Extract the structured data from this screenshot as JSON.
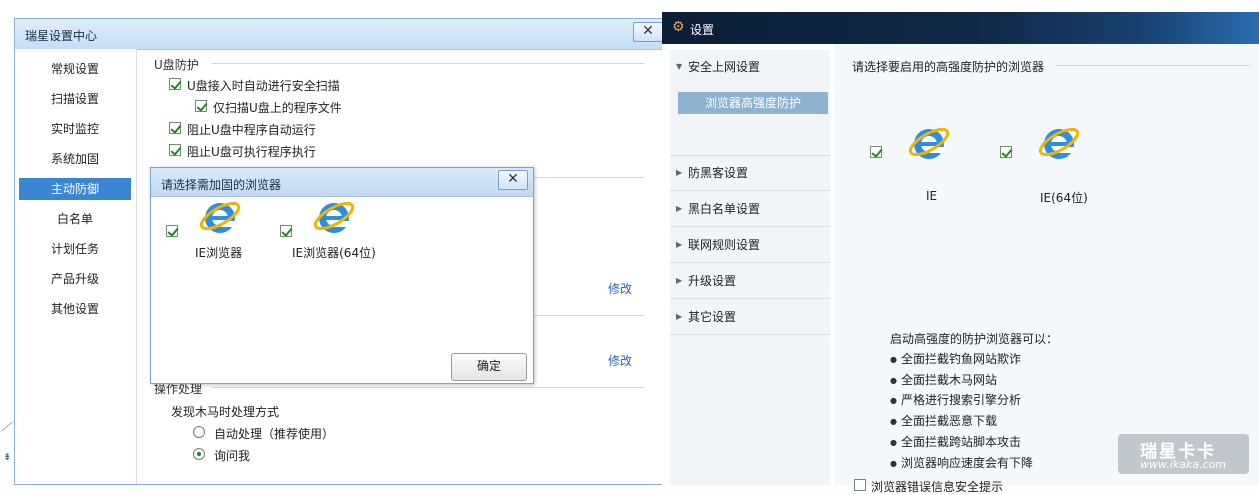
{
  "left_window": {
    "title": "瑞星设置中心",
    "close": "✕",
    "nav": [
      "常规设置",
      "扫描设置",
      "实时监控",
      "系统加固",
      "主动防御",
      "白名单",
      "计划任务",
      "产品升级",
      "其他设置"
    ],
    "active_index": 4,
    "usb_section": {
      "title": "U盘防护",
      "options": [
        {
          "label": "U盘接入时自动进行安全扫描",
          "checked": true
        },
        {
          "label": "仅扫描U盘上的程序文件",
          "checked": true
        },
        {
          "label": "阻止U盘中程序自动运行",
          "checked": true
        },
        {
          "label": "阻止U盘可执行程序执行",
          "checked": true
        }
      ]
    },
    "modify_1": "修改",
    "modify_2": "修改",
    "handle_section": {
      "title": "操作处理",
      "question": "发现木马时处理方式",
      "options": [
        {
          "label": "自动处理（推荐使用）",
          "selected": false
        },
        {
          "label": "询问我",
          "selected": true
        }
      ]
    }
  },
  "modal": {
    "title": "请选择需加固的浏览器",
    "close": "✕",
    "browsers": [
      {
        "label": "IE浏览器",
        "checked": true
      },
      {
        "label": "IE浏览器(64位)",
        "checked": true
      }
    ],
    "ok": "确定"
  },
  "right_window": {
    "title": "设置",
    "nav_group": "安全上网设置",
    "nav_sub_active": "浏览器高强度防护",
    "nav_items": [
      "防黑客设置",
      "黑白名单设置",
      "联网规则设置",
      "升级设置",
      "其它设置"
    ],
    "main_heading": "请选择要启用的高强度防护的浏览器",
    "browsers": [
      {
        "label": "IE",
        "checked": true
      },
      {
        "label": "IE(64位)",
        "checked": true
      }
    ],
    "info_heading": "启动高强度的防护浏览器可以：",
    "bullets": [
      "全面拦截钓鱼网站欺诈",
      "全面拦截木马网站",
      "严格进行搜索引擎分析",
      "全面拦截恶意下载",
      "全面拦截跨站脚本攻击",
      "浏览器响应速度会有下降"
    ],
    "bottom_option": {
      "label": "浏览器错误信息安全提示",
      "checked": false
    }
  },
  "watermark": {
    "main": "瑞星卡卡",
    "sub": "www.ikaka.com"
  },
  "colors": {
    "nav_active": "#3a86d3",
    "right_title": "#0f2a4a",
    "ie_blue": "#2d8de0",
    "ie_ring": "#f0b400",
    "link": "#2a64b6"
  }
}
